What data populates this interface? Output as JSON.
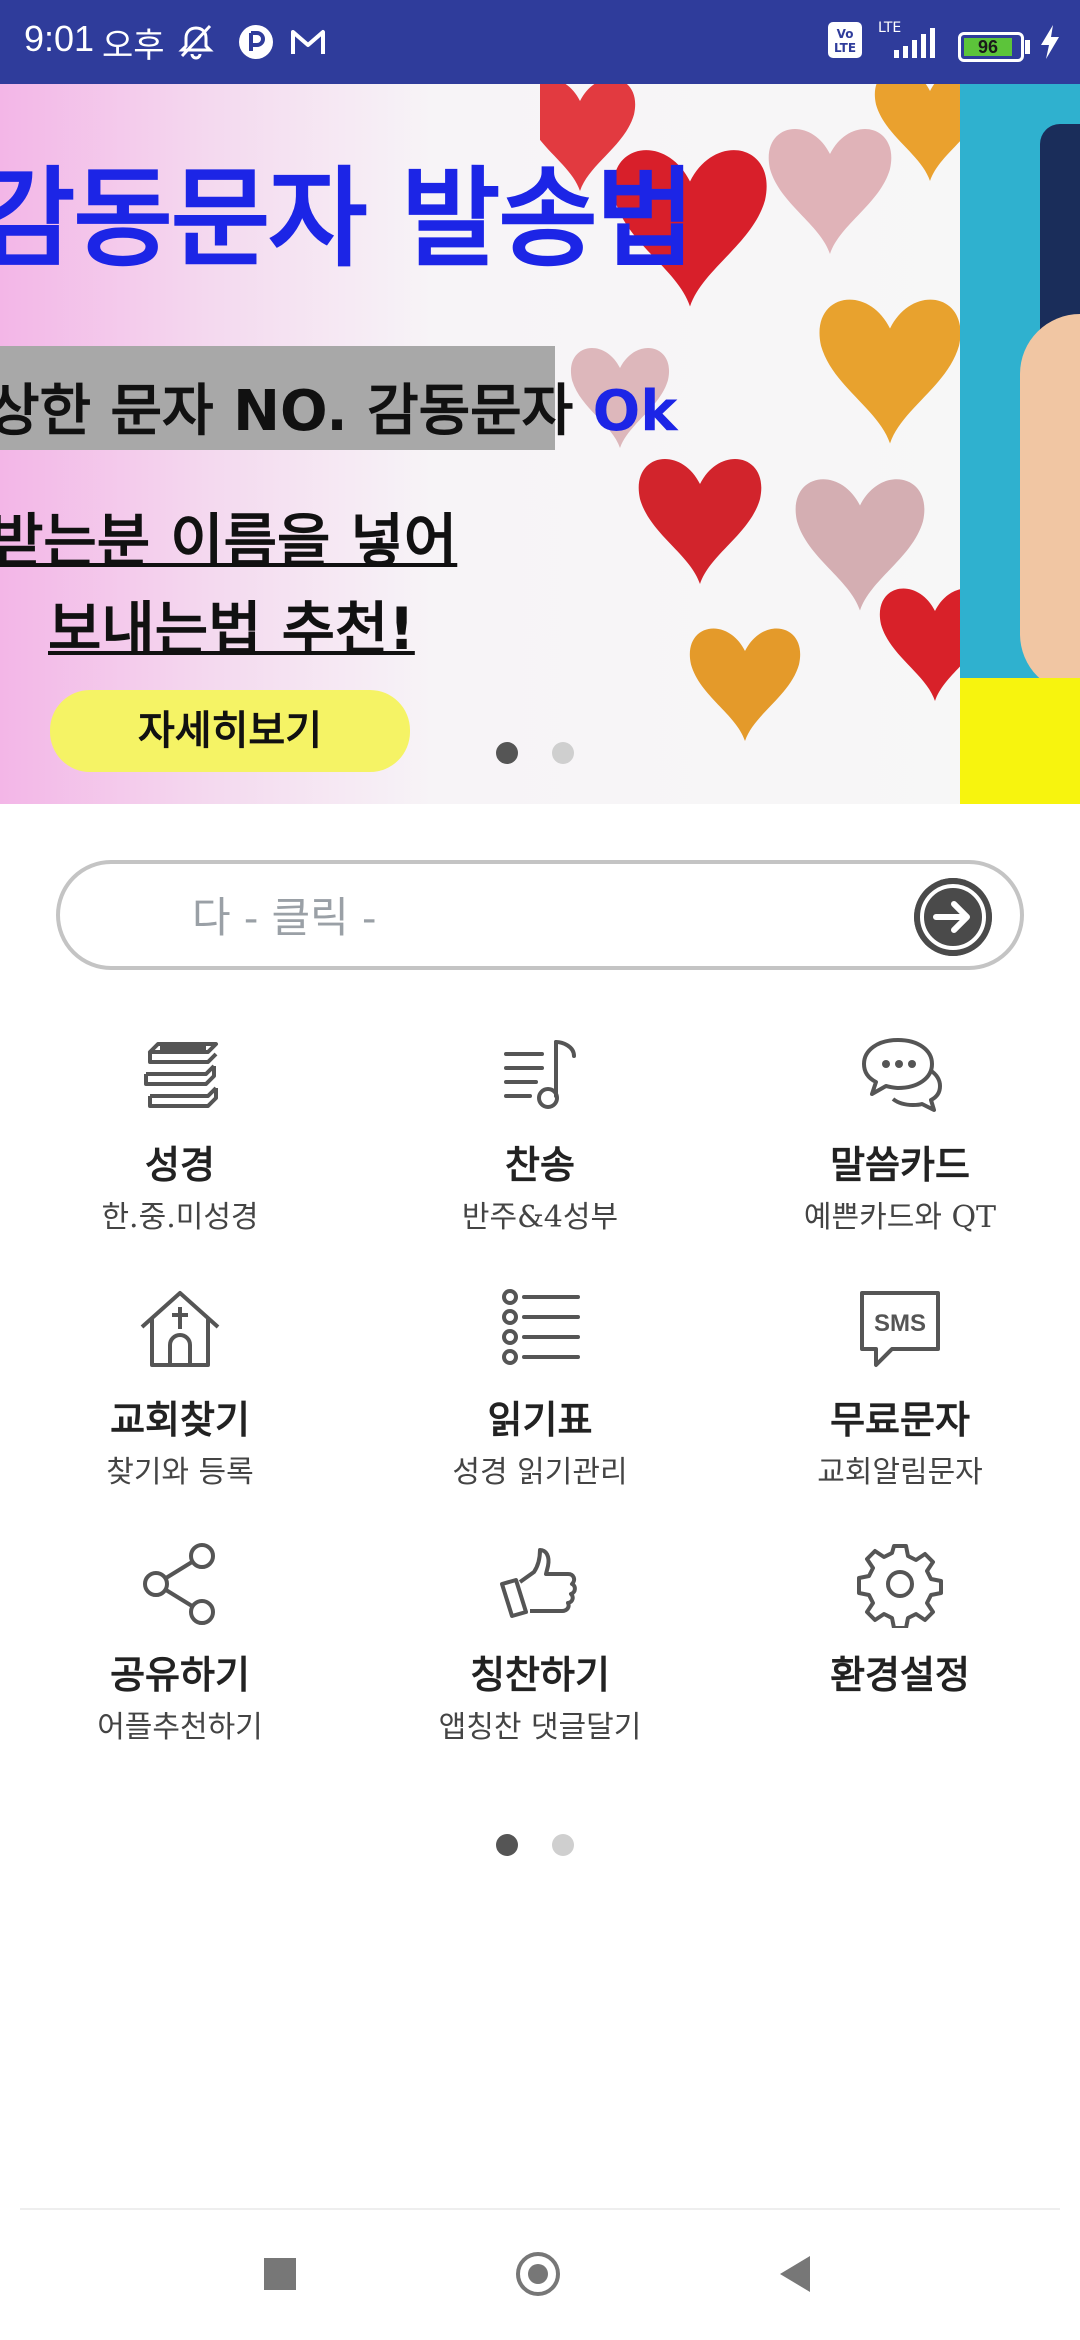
{
  "status_bar": {
    "time": "9:01",
    "ampm": "오후",
    "volte": "Vo LTE",
    "network": "LTE",
    "battery": "96"
  },
  "banner": {
    "title": "감동문자 발송법",
    "subtitle_prefix": "상한 문자 NO. 감동문자 ",
    "subtitle_ok": "Ok",
    "line1": "받는분 이름을 넣어",
    "line2": "보내는법 추천!",
    "button": "자세히보기",
    "page_count": 2,
    "active_page": 1
  },
  "search": {
    "placeholder": "다 - 클릭 -"
  },
  "menu": [
    {
      "icon": "bible-books-icon",
      "title": "성경",
      "subtitle": "한.중.미성경"
    },
    {
      "icon": "music-note-icon",
      "title": "찬송",
      "subtitle": "반주&4성부"
    },
    {
      "icon": "chat-bubbles-icon",
      "title": "말씀카드",
      "subtitle": "예쁜카드와 QT"
    },
    {
      "icon": "church-icon",
      "title": "교회찾기",
      "subtitle": "찾기와 등록"
    },
    {
      "icon": "list-icon",
      "title": "읽기표",
      "subtitle": "성경 읽기관리"
    },
    {
      "icon": "sms-icon",
      "title": "무료문자",
      "subtitle": "교회알림문자"
    },
    {
      "icon": "share-icon",
      "title": "공유하기",
      "subtitle": "어플추천하기"
    },
    {
      "icon": "thumbs-up-icon",
      "title": "칭찬하기",
      "subtitle": "앱칭찬 댓글달기"
    },
    {
      "icon": "gear-icon",
      "title": "환경설정",
      "subtitle": ""
    }
  ],
  "menu_pages": {
    "count": 2,
    "active": 1
  },
  "colors": {
    "status_bar": "#2f3c9b",
    "banner_title": "#1c25e6",
    "banner_button": "#f5f365",
    "icon": "#555555"
  }
}
